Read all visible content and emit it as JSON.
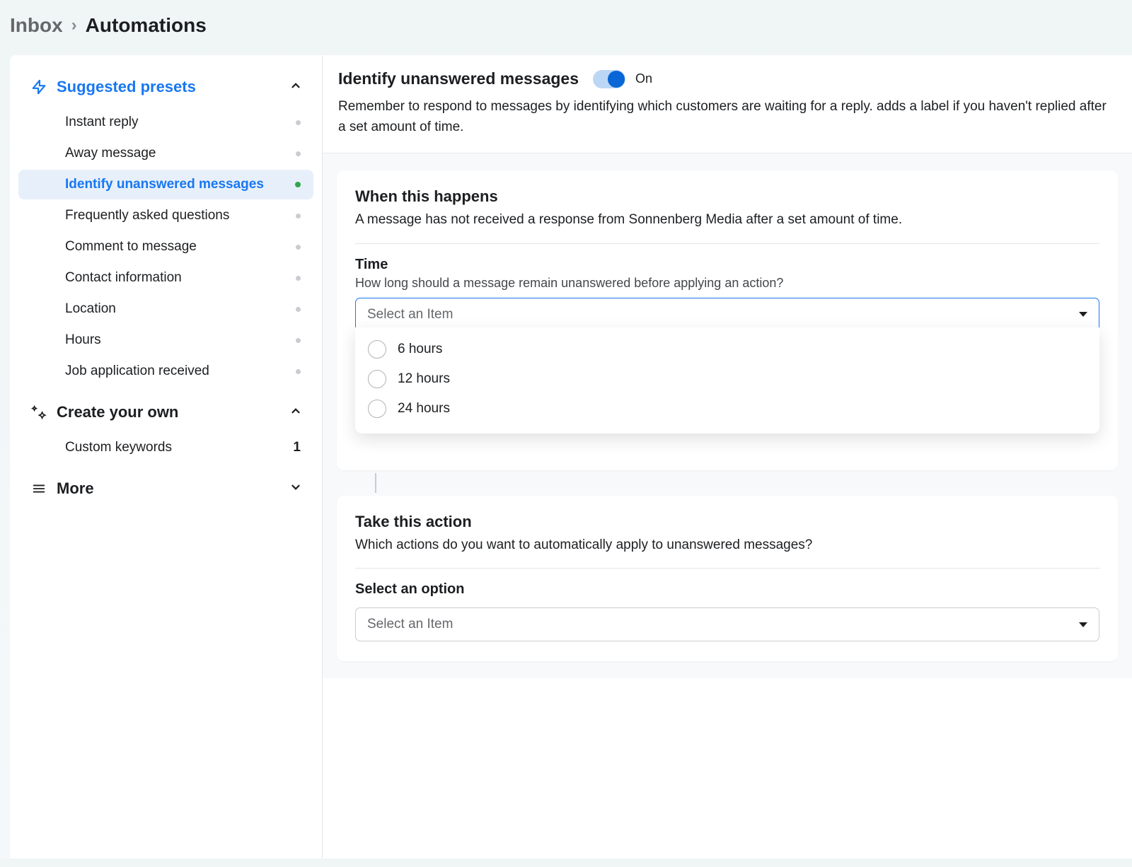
{
  "breadcrumb": {
    "parent": "Inbox",
    "current": "Automations"
  },
  "sidebar": {
    "presets_title": "Suggested presets",
    "items": [
      {
        "label": "Instant reply"
      },
      {
        "label": "Away message"
      },
      {
        "label": "Identify unanswered messages"
      },
      {
        "label": "Frequently asked questions"
      },
      {
        "label": "Comment to message"
      },
      {
        "label": "Contact information"
      },
      {
        "label": "Location"
      },
      {
        "label": "Hours"
      },
      {
        "label": "Job application received"
      }
    ],
    "create_title": "Create your own",
    "create_items": [
      {
        "label": "Custom keywords",
        "count": "1"
      }
    ],
    "more_title": "More"
  },
  "main": {
    "title": "Identify unanswered messages",
    "toggle_label": "On",
    "description": "Remember to respond to messages by identifying which customers are waiting for a reply. adds a label if you haven't replied after a set amount of time.",
    "when_card": {
      "title": "When this happens",
      "subtitle": "A message has not received a response from Sonnenberg Media after a set amount of time.",
      "time_label": "Time",
      "time_help": "How long should a message remain unanswered before applying an action?",
      "select_placeholder": "Select an Item",
      "options": [
        {
          "label": "6 hours"
        },
        {
          "label": "12 hours"
        },
        {
          "label": "24 hours"
        }
      ]
    },
    "action_card": {
      "title": "Take this action",
      "subtitle": "Which actions do you want to automatically apply to unanswered messages?",
      "option_label": "Select an option",
      "select_placeholder": "Select an Item"
    }
  }
}
